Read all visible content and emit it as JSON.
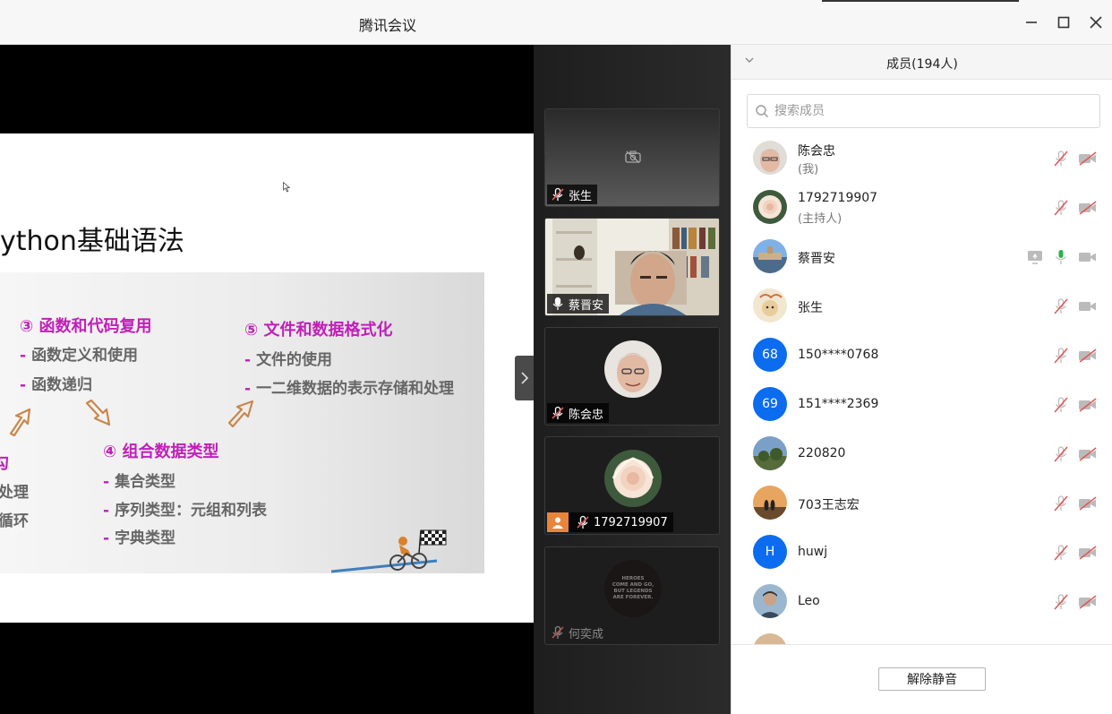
{
  "window": {
    "title": "腾讯会议"
  },
  "slide": {
    "title": "ython基础语法",
    "sections": [
      {
        "heading": "③ 函数和代码复用",
        "items": [
          "函数定义和使用",
          "函数递归"
        ]
      },
      {
        "heading": "⑤ 文件和数据格式化",
        "items": [
          "文件的使用",
          "一二维数据的表示存储和处理"
        ]
      },
      {
        "heading": "④ 组合数据类型",
        "items": [
          "集合类型",
          "序列类型：元组和列表",
          "字典类型"
        ]
      },
      {
        "heading": "勾",
        "items": [
          "处理",
          "循环"
        ]
      }
    ],
    "dash": "-"
  },
  "tiles": [
    {
      "name": "张生",
      "mic": "muted"
    },
    {
      "name": "蔡晋安",
      "mic": "on"
    },
    {
      "name": "陈会忠",
      "mic": "muted"
    },
    {
      "name": "1792719907",
      "mic": "muted",
      "host": true
    },
    {
      "name": "何奕成",
      "mic": "muted",
      "avatar_text": [
        "HEROES",
        "COME AND GO,",
        "BUT LEGENDS",
        "ARE FOREVER."
      ]
    }
  ],
  "panel": {
    "title": "成员(194人)",
    "search_placeholder": "搜索成员",
    "members": [
      {
        "name": "陈会忠",
        "role": "(我)",
        "mic": "muted",
        "cam": "off"
      },
      {
        "name": "1792719907",
        "role": "(主持人)",
        "mic": "muted",
        "cam": "off"
      },
      {
        "name": "蔡晋安",
        "mic": "on",
        "cam": "on",
        "sharing": true
      },
      {
        "name": "张生",
        "mic": "muted",
        "cam": "on"
      },
      {
        "name": "150****0768",
        "avatar_text": "68",
        "mic": "muted",
        "cam": "off"
      },
      {
        "name": "151****2369",
        "avatar_text": "69",
        "mic": "muted",
        "cam": "off"
      },
      {
        "name": "220820",
        "mic": "muted",
        "cam": "off"
      },
      {
        "name": "703王志宏",
        "mic": "muted",
        "cam": "off"
      },
      {
        "name": "huwj",
        "avatar_text": "H",
        "mic": "muted",
        "cam": "off"
      },
      {
        "name": "Leo",
        "mic": "muted",
        "cam": "off"
      }
    ],
    "unmute_label": "解除静音"
  },
  "colors": {
    "accent_blue": "#0b6cf0",
    "mic_on_green": "#2bb24c",
    "muted_red": "#e25757",
    "slide_heading": "#c020b8"
  }
}
